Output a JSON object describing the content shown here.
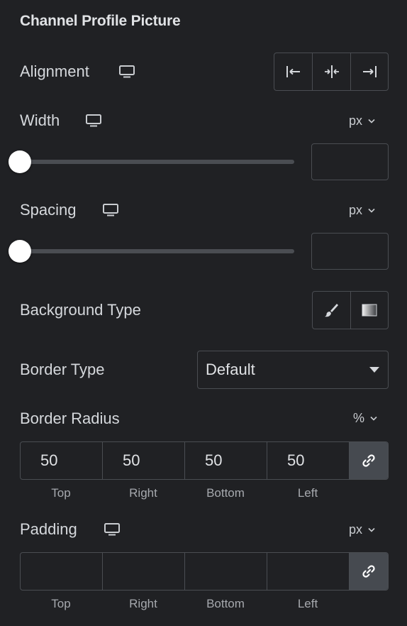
{
  "section_title": "Channel Profile Picture",
  "alignment": {
    "label": "Alignment",
    "device_icon": "monitor-icon",
    "options": [
      "align-left-icon",
      "align-center-icon",
      "align-right-icon"
    ]
  },
  "width": {
    "label": "Width",
    "unit": "px",
    "value": "",
    "slider_level": 0
  },
  "spacing": {
    "label": "Spacing",
    "unit": "px",
    "value": "",
    "slider_level": 0
  },
  "background_type": {
    "label": "Background Type",
    "options": [
      "brush-icon",
      "gradient-icon"
    ]
  },
  "border_type": {
    "label": "Border Type",
    "selected": "Default"
  },
  "border_radius": {
    "label": "Border Radius",
    "unit": "%",
    "values": {
      "top": "50",
      "right": "50",
      "bottom": "50",
      "left": "50"
    },
    "side_labels": {
      "top": "Top",
      "right": "Right",
      "bottom": "Bottom",
      "left": "Left"
    }
  },
  "padding": {
    "label": "Padding",
    "unit": "px",
    "values": {
      "top": "",
      "right": "",
      "bottom": "",
      "left": ""
    },
    "side_labels": {
      "top": "Top",
      "right": "Right",
      "bottom": "Bottom",
      "left": "Left"
    }
  },
  "colors": {
    "background": "#202124",
    "border": "#4a4d52",
    "link_button": "#464a50",
    "text": "#d5d8dc"
  }
}
